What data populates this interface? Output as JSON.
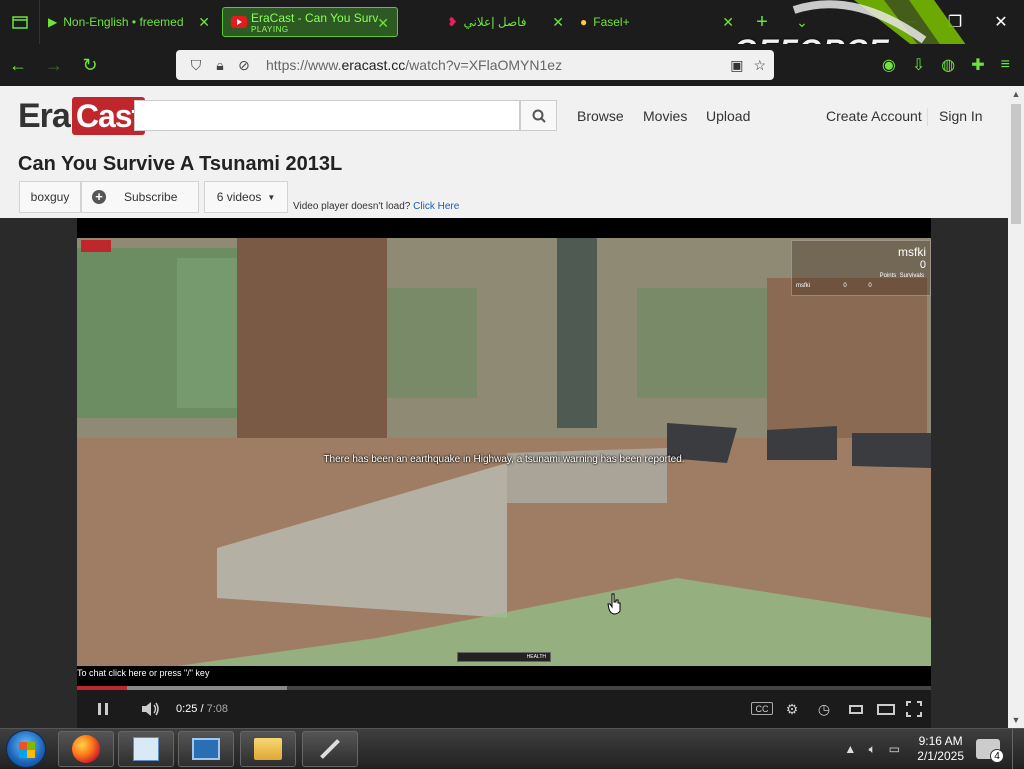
{
  "browser": {
    "tabs": [
      {
        "title": "Non-English • freemed"
      },
      {
        "title": "EraCast - Can You Surv",
        "subtitle": "PLAYING"
      },
      {
        "title": "فاصل إعلاني"
      },
      {
        "title": "Fasel+"
      }
    ],
    "url": {
      "prefix": "https://www.",
      "domain": "eracast.cc",
      "path": "/watch?v=XFlaOMYN1ez"
    },
    "overlay_text": "GEFORCE"
  },
  "site": {
    "logo": {
      "part1": "Era",
      "part2": "Cast"
    },
    "search_placeholder": "",
    "nav": {
      "browse": "Browse",
      "movies": "Movies",
      "upload": "Upload",
      "create_account": "Create Account",
      "sign_in": "Sign In"
    }
  },
  "video": {
    "title": "Can You Survive A Tsunami 2013L",
    "channel": "boxguy",
    "subscribe": "Subscribe",
    "videos": "6 videos",
    "player_note": "Video player doesn't load?",
    "player_note_link": "Click Here",
    "caption": "There has been an earthquake in Highway, a tsunami warning has been reported.",
    "chat_hint": "To chat click here or press \"/\" key",
    "health_label": "HEALTH",
    "scoreboard": {
      "player": "msfki",
      "score": "0",
      "col1": "Points",
      "col2": "Survivals",
      "row_name": "msfki",
      "row_points": "0",
      "row_survivals": "0"
    },
    "current_time": "0:25",
    "duration": "7:08",
    "progress_fraction": 0.058,
    "cc_label": "CC"
  },
  "taskbar": {
    "time": "9:16 AM",
    "date": "2/1/2025",
    "notification_count": "4"
  },
  "colors": {
    "accent_green": "#6ee43a",
    "brand_red": "#c0272d"
  }
}
